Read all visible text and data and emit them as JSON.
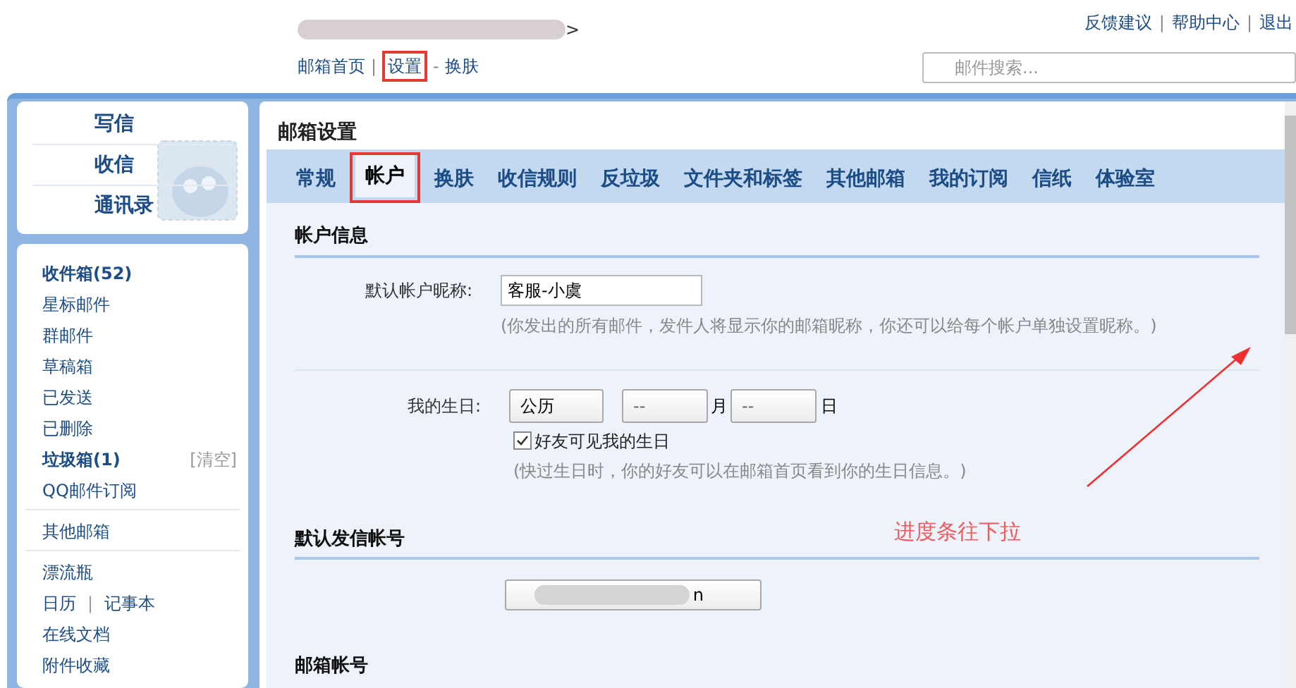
{
  "header": {
    "user_suffix": ">",
    "nav": [
      {
        "label": "邮箱首页",
        "annotated": false
      },
      {
        "label": "设置",
        "annotated": true
      },
      {
        "label": "换肤",
        "annotated": false
      }
    ],
    "nav_separators": [
      "|",
      "-"
    ],
    "top_links": [
      "反馈建议",
      "帮助中心",
      "退出"
    ],
    "top_separators": [
      "|",
      "|"
    ],
    "search": {
      "placeholder": "邮件搜索..."
    }
  },
  "sidebar": {
    "actions": [
      "写信",
      "收信",
      "通讯录"
    ],
    "folder_groups": [
      [
        {
          "kind": "folder",
          "label": "收件箱(52)",
          "bold": true
        },
        {
          "kind": "folder",
          "label": "星标邮件",
          "bold": false
        },
        {
          "kind": "folder",
          "label": "群邮件",
          "bold": false
        },
        {
          "kind": "folder",
          "label": "草稿箱",
          "bold": false
        },
        {
          "kind": "folder",
          "label": "已发送",
          "bold": false
        },
        {
          "kind": "folder",
          "label": "已删除",
          "bold": false
        },
        {
          "kind": "folder",
          "label": "垃圾箱(1)",
          "bold": true,
          "action": "[清空]"
        },
        {
          "kind": "folder",
          "label": "QQ邮件订阅",
          "bold": false
        }
      ],
      [
        {
          "kind": "folder",
          "label": "其他邮箱",
          "bold": false
        }
      ],
      [
        {
          "kind": "folder",
          "label": "漂流瓶",
          "bold": false
        },
        {
          "kind": "pair",
          "labels": [
            "日历",
            "记事本"
          ],
          "separator": "|"
        },
        {
          "kind": "folder",
          "label": "在线文档",
          "bold": false
        },
        {
          "kind": "folder",
          "label": "附件收藏",
          "bold": false
        }
      ]
    ]
  },
  "settings": {
    "title": "邮箱设置",
    "tabs": [
      {
        "label": "常规",
        "selected": false,
        "annotated": false
      },
      {
        "label": "帐户",
        "selected": true,
        "annotated": true
      },
      {
        "label": "换肤",
        "selected": false,
        "annotated": false
      },
      {
        "label": "收信规则",
        "selected": false,
        "annotated": false
      },
      {
        "label": "反垃圾",
        "selected": false,
        "annotated": false
      },
      {
        "label": "文件夹和标签",
        "selected": false,
        "annotated": false
      },
      {
        "label": "其他邮箱",
        "selected": false,
        "annotated": false
      },
      {
        "label": "我的订阅",
        "selected": false,
        "annotated": false
      },
      {
        "label": "信纸",
        "selected": false,
        "annotated": false
      },
      {
        "label": "体验室",
        "selected": false,
        "annotated": false
      }
    ],
    "account_info": {
      "heading": "帐户信息",
      "nickname_label": "默认帐户昵称:",
      "nickname_value": "客服-小虞",
      "nickname_hint": "(你发出的所有邮件，发件人将显示你的邮箱昵称，你还可以给每个帐户单独设置昵称。)",
      "birthday_label": "我的生日:",
      "calendar": "公历",
      "month_value": "--",
      "month_unit": "月",
      "day_value": "--",
      "day_unit": "日",
      "friends_visible_label": "好友可见我的生日",
      "friends_visible_checked": true,
      "birthday_hint": "(快过生日时，你的好友可以在邮箱首页看到你的生日信息。)"
    },
    "default_sender": {
      "heading": "默认发信帐号",
      "account_suffix": "n"
    },
    "mail_accounts": {
      "heading": "邮箱帐号"
    }
  },
  "annotation": {
    "text": "进度条往下拉"
  }
}
